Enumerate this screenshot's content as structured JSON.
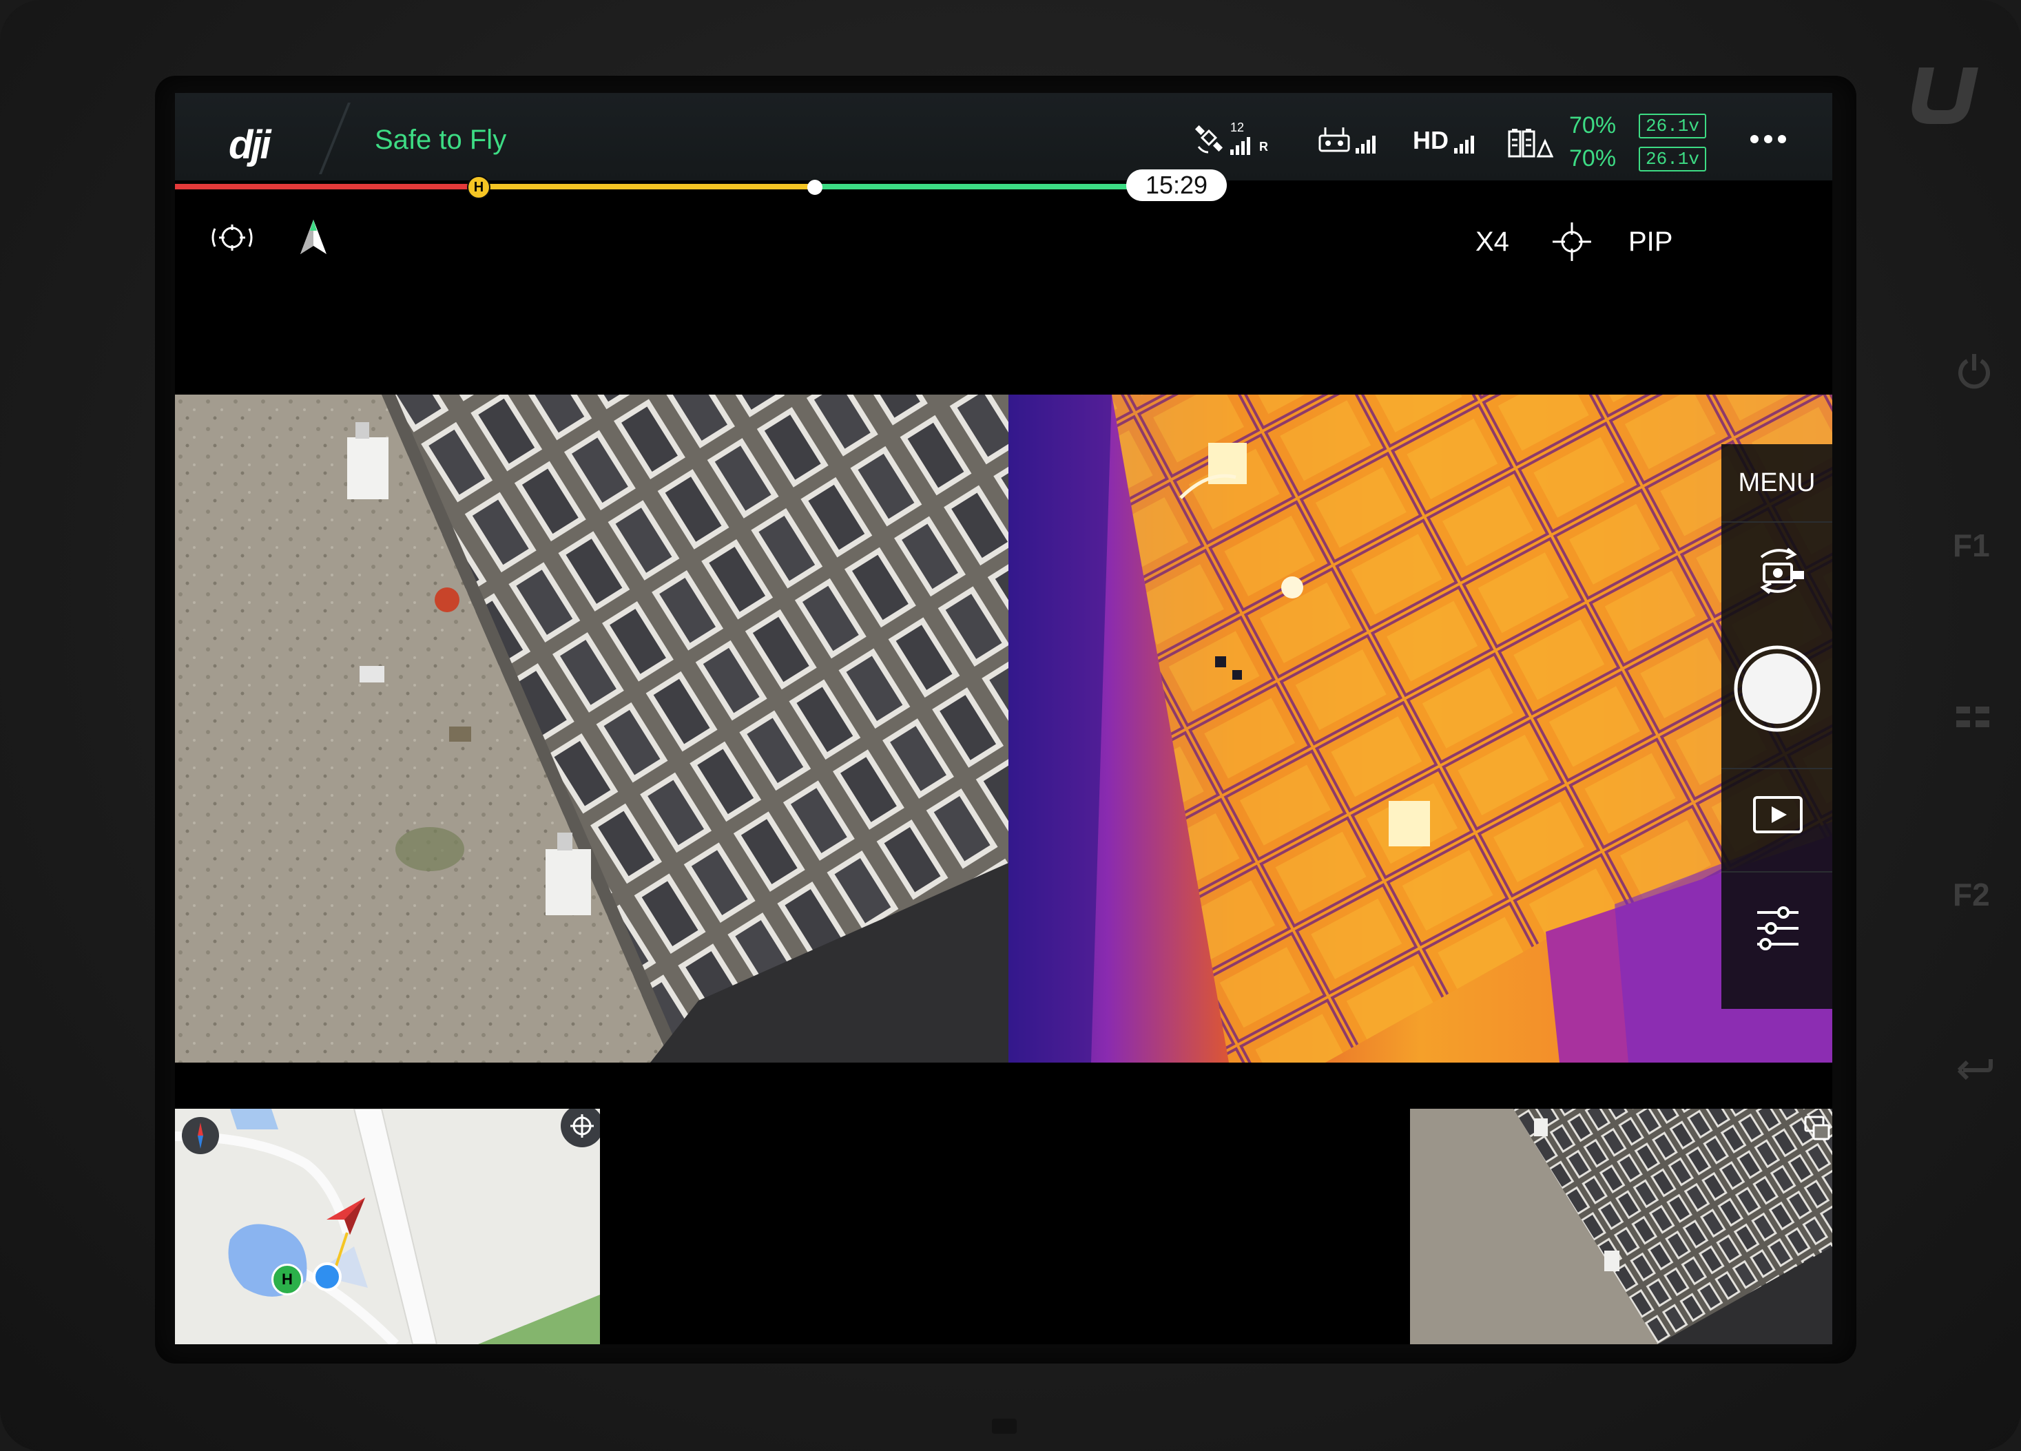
{
  "header": {
    "brand": "dji",
    "flight_status": "Safe to Fly",
    "gps_satellites": "12",
    "gps_signal_suffix": "R",
    "video_link_label": "HD",
    "battery": {
      "aircraft_percent": "70%",
      "aircraft_voltage": "26.1v",
      "rc_percent": "70%",
      "rc_voltage": "26.1v"
    },
    "more_menu_icon": "more-dots-icon"
  },
  "flight_bar": {
    "remaining_time": "15:29",
    "home_marker": "H",
    "colors": {
      "low": "#e43a3a",
      "medium": "#f5c524",
      "safe": "#3ddc84"
    }
  },
  "camera_toolbar": {
    "zoom_label": "X4",
    "pip_label": "PIP"
  },
  "camera_panel": {
    "menu_label": "MENU"
  },
  "map": {
    "home_label": "H"
  },
  "device": {
    "side_keys": [
      "F1",
      "F2"
    ]
  },
  "theme": {
    "accent_green": "#3ddc84",
    "bar_background": "#15191b"
  }
}
